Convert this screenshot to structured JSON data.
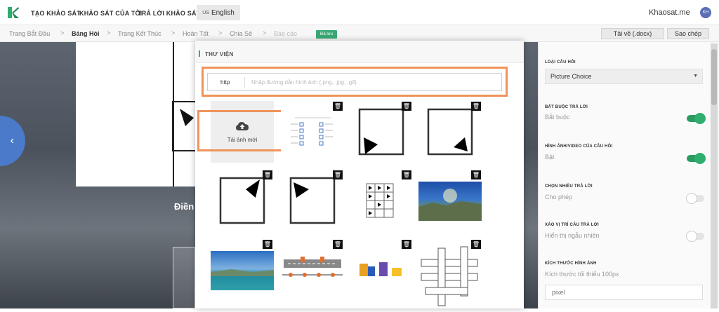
{
  "topbar": {
    "nav": [
      "TẠO KHẢO SÁT",
      "KHẢO SÁT CỦA TÔI",
      "TRẢ LỜI KHẢO SÁT"
    ],
    "lang_flag": "US",
    "lang_label": "English",
    "brand": "Khaosat.me",
    "avatar": "KH"
  },
  "breadcrumb": {
    "items": [
      "Trang Bắt Đầu",
      "Bảng Hỏi",
      "Trang Kết Thúc",
      "Hoàn Tất",
      "Chia Sẻ",
      "Báo cáo"
    ],
    "active_index": 1,
    "separator": ">",
    "saved_badge": "Đã lưu",
    "download_button": "Tải về (.docx)",
    "copy_button": "Sao chép"
  },
  "canvas": {
    "prev_arrow": "‹",
    "question_text": "Điền"
  },
  "modal": {
    "title": "THƯ VIỆN",
    "url_prefix": "http",
    "url_placeholder": "Nhập đường dẫn hình ảnh (.png, .jpg, .gif)",
    "upload_label": "Tải ảnh mới"
  },
  "settings": {
    "question_type_label": "LOẠI CÂU HỎI",
    "question_type_value": "Picture Choice",
    "required_label": "BẮT BUỘC TRẢ LỜI",
    "required_value": "Bắt buộc",
    "required_on": true,
    "media_label": "HÌNH ẢNH/VIDEO CỦA CÂU HỎI",
    "media_value": "Bật",
    "media_on": true,
    "multi_label": "CHỌN NHIỀU TRẢ LỜI",
    "multi_value": "Cho phép",
    "multi_on": false,
    "shuffle_label": "XÁO VỊ TRÍ CÂU TRẢ LỜI",
    "shuffle_value": "Hiển thị ngẫu nhiên",
    "shuffle_on": false,
    "size_label": "KÍCH THƯỚC HÌNH ẢNH",
    "size_value": "Kích thước tối thiểu 100px",
    "size_placeholder": "pixel"
  },
  "colors": {
    "accent_green": "#3aa874",
    "highlight_orange": "#f0935a",
    "nav_blue": "#4a7ac9"
  }
}
